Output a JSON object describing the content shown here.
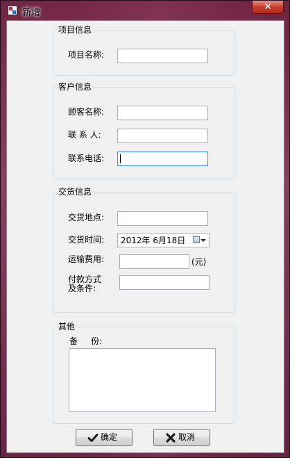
{
  "window": {
    "title": "新增",
    "close_label": "✕",
    "app_icon": "app-icon"
  },
  "project": {
    "group_title": "项目信息",
    "name_label": "项目名称:",
    "name_value": ""
  },
  "customer": {
    "group_title": "客户信息",
    "customer_name_label": "顾客名称:",
    "customer_name_value": "",
    "contact_label": "联 系 人:",
    "contact_value": "",
    "phone_label": "联系电话:",
    "phone_value": ""
  },
  "delivery": {
    "group_title": "交货信息",
    "location_label": "交货地点:",
    "location_value": "",
    "time_label": "交货时间:",
    "date_value": "2012年  6月18日",
    "shipping_label": "运输费用:",
    "shipping_value": "",
    "shipping_unit": "(元)",
    "payment_label_line1": "付款方式",
    "payment_label_line2": "及条件:",
    "payment_value": ""
  },
  "other": {
    "group_title": "其他",
    "remark_label": "备     份:",
    "remark_value": ""
  },
  "buttons": {
    "ok_label": "确定",
    "ok_icon": "check-icon",
    "cancel_label": "取消",
    "cancel_icon": "x-icon"
  }
}
